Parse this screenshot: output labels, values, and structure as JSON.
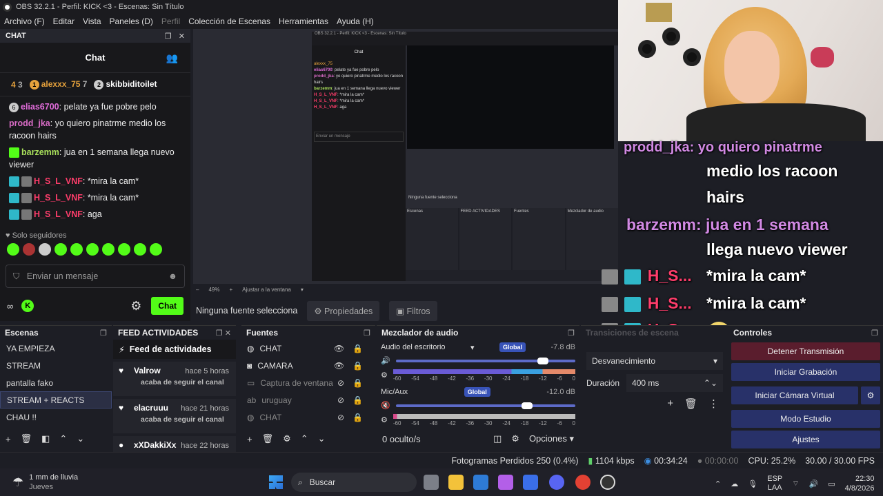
{
  "window": {
    "title": "OBS 32.2.1 - Perfil: KICK <3 - Escenas: Sin Título"
  },
  "menu": [
    "Archivo (F)",
    "Editar",
    "Vista",
    "Paneles (D)",
    "Perfil",
    "Colección de Escenas",
    "Herramientas",
    "Ayuda (H)"
  ],
  "chat_dock": {
    "dock_title": "CHAT",
    "header": "Chat",
    "leaders": [
      {
        "rank": "4",
        "count": "3"
      },
      {
        "rank": "1",
        "name": "alexxx_75",
        "count": "7"
      },
      {
        "rank": "2",
        "name": "skibbiditoilet"
      }
    ],
    "messages": [
      {
        "badge": "6",
        "user": "elias6700",
        "text": "pelate ya fue pobre pelo"
      },
      {
        "user": "prodd_jka",
        "text": "yo quiero pinatrme medio los racoon hairs"
      },
      {
        "user": "barzemm",
        "text": "jua en 1 semana llega nuevo viewer"
      },
      {
        "user": "H_S_L_VNF",
        "text": "*mira la cam*"
      },
      {
        "user": "H_S_L_VNF",
        "text": "*mira la cam*"
      },
      {
        "user": "H_S_L_VNF",
        "text": "aga"
      }
    ],
    "followers_label": "Solo seguidores",
    "input_placeholder": "Enviar un mensaje",
    "send_label": "Chat"
  },
  "preview_bar": {
    "zoom": "49%",
    "fit": "Ajustar a la ventana"
  },
  "source_bar": {
    "none_selected": "Ninguna fuente selecciona",
    "properties": "Propiedades",
    "filters": "Filtros"
  },
  "overlay": {
    "lines": [
      "prodd_jka: yo quiero pinatrme",
      "medio los racoon",
      "hairs",
      "barzemm: jua en 1 semana",
      "llega nuevo viewer"
    ],
    "user_short": "H_S...",
    "cam": "*mira la cam*"
  },
  "scenes": {
    "title": "Escenas",
    "items": [
      "YA EMPIEZA",
      "STREAM",
      "pantalla fako",
      "STREAM + REACTS",
      "CHAU !!"
    ],
    "selected": 3
  },
  "feed": {
    "title": "FEED ACTIVIDADES",
    "header": "Feed de actividades",
    "items": [
      {
        "name": "Valrow",
        "time": "hace 5 horas",
        "sub": "acaba de seguir el canal"
      },
      {
        "name": "elacruuu",
        "time": "hace 21 horas",
        "sub": "acaba de seguir el canal"
      },
      {
        "name": "xXDakkiXx",
        "time": "hace 22 horas",
        "sub": ""
      }
    ]
  },
  "sources": {
    "title": "Fuentes",
    "items": [
      {
        "name": "CHAT",
        "icon": "globe-icon",
        "visible": true
      },
      {
        "name": "CAMARA",
        "icon": "camera-icon",
        "visible": true
      },
      {
        "name": "Captura de ventana",
        "icon": "window-icon",
        "visible": false
      },
      {
        "name": "uruguay",
        "icon": "text-icon",
        "visible": false
      },
      {
        "name": "CHAT",
        "icon": "globe-icon",
        "visible": false
      }
    ]
  },
  "mixer": {
    "title": "Mezclador de audio",
    "channels": [
      {
        "name": "Audio del escritorio",
        "badge": "Global",
        "db": "-7.8 dB",
        "level": 0.82
      },
      {
        "name": "Mic/Aux",
        "badge": "Global",
        "db": "-12.0 dB",
        "level": 0.73
      }
    ],
    "ticks": [
      "-60",
      "-54",
      "-48",
      "-42",
      "-36",
      "-30",
      "-24",
      "-18",
      "-12",
      "-6",
      "0"
    ],
    "hidden": "0 oculto/s",
    "options": "Opciones"
  },
  "transitions": {
    "title": "Transiciones de escena",
    "type": "Desvanecimiento",
    "duration_label": "Duración",
    "duration": "400 ms"
  },
  "controls": {
    "title": "Controles",
    "buttons": [
      "Detener Transmisión",
      "Iniciar Grabación",
      "Iniciar Cámara Virtual",
      "Modo Estudio",
      "Ajustes"
    ]
  },
  "status": {
    "dropped": "Fotogramas Perdidos 250 (0.4%)",
    "kbps": "1104 kbps",
    "stream_time": "00:34:24",
    "rec_time": "00:00:00",
    "cpu": "CPU: 25.2%",
    "fps": "30.00 / 30.00 FPS"
  },
  "taskbar": {
    "weather": "1 mm de lluvia",
    "weather_day": "Jueves",
    "search": "Buscar",
    "lang": "ESP",
    "lang2": "LAA",
    "time": "22:30",
    "date": "4/8/2026"
  }
}
